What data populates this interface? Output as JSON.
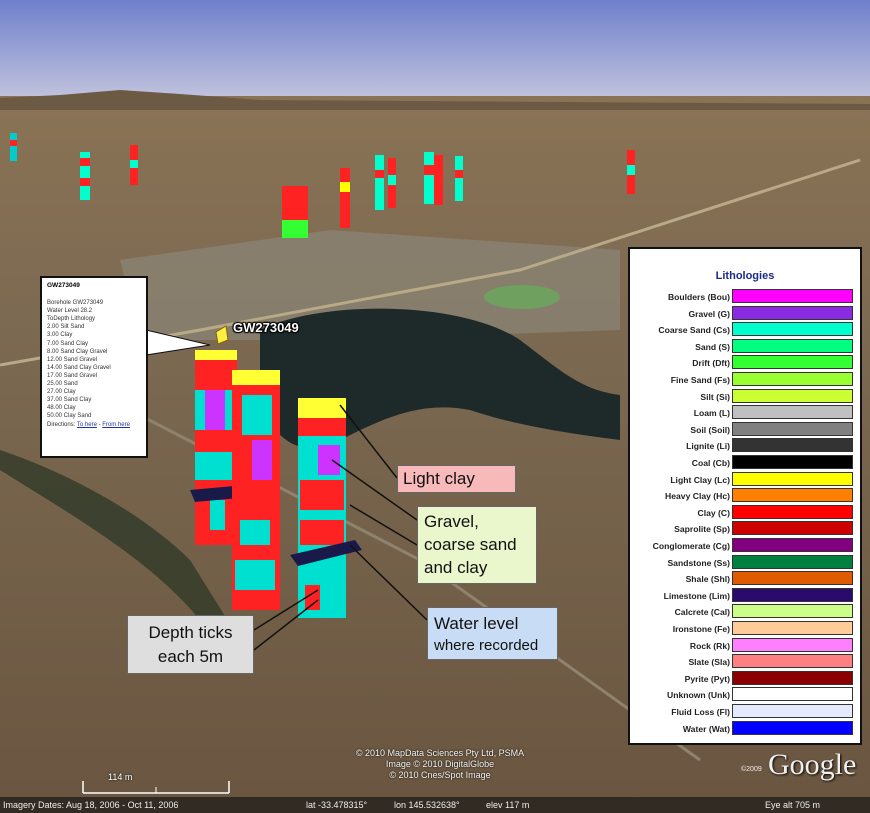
{
  "balloon": {
    "title": "GW273049",
    "lines": [
      "Borehole GW273049",
      "Water Level 28.2",
      "ToDepth Lithology",
      "2.00 Silt Sand",
      "3.00 Clay",
      "7.00 Sand Clay",
      "8.00 Sand Clay Gravel",
      "12.00 Sand Gravel",
      "14.00 Sand Clay Gravel",
      "17.00 Sand Gravel",
      "25.00 Sand",
      "27.00 Clay",
      "37.00 Sand Clay",
      "48.00 Clay",
      "50.00 Clay Sand"
    ],
    "directions_label": "Directions:",
    "to_here": "To here",
    "sep": " - ",
    "from_here": "From here"
  },
  "placemark": {
    "label": "GW273049"
  },
  "callouts": {
    "light_clay": "Light clay",
    "gravel_1": "Gravel,",
    "gravel_2": "coarse sand",
    "gravel_3": "and clay",
    "depth_1": "Depth ticks",
    "depth_2": "each 5m",
    "water_1": "Water level",
    "water_2": "where recorded"
  },
  "legend": {
    "title": "Lithologies",
    "items": [
      {
        "label": "Boulders (Bou)",
        "color": "#ff00ff"
      },
      {
        "label": "Gravel (G)",
        "color": "#8a2be2"
      },
      {
        "label": "Coarse Sand (Cs)",
        "color": "#00ffcc"
      },
      {
        "label": "Sand (S)",
        "color": "#00ff80"
      },
      {
        "label": "Drift (Dft)",
        "color": "#33ff33"
      },
      {
        "label": "Fine Sand (Fs)",
        "color": "#99ff33"
      },
      {
        "label": "Silt (Si)",
        "color": "#ccff33"
      },
      {
        "label": "Loam (L)",
        "color": "#c0c0c0"
      },
      {
        "label": "Soil (Soil)",
        "color": "#808080"
      },
      {
        "label": "Lignite (Li)",
        "color": "#333333"
      },
      {
        "label": "Coal (Cb)",
        "color": "#000000"
      },
      {
        "label": "Light Clay (Lc)",
        "color": "#ffff00"
      },
      {
        "label": "Heavy Clay (Hc)",
        "color": "#ff8000"
      },
      {
        "label": "Clay (C)",
        "color": "#ff0000"
      },
      {
        "label": "Saprolite (Sp)",
        "color": "#cc0000"
      },
      {
        "label": "Conglomerate (Cg)",
        "color": "#800080"
      },
      {
        "label": "Sandstone (Ss)",
        "color": "#008040"
      },
      {
        "label": "Shale (Shl)",
        "color": "#e05a00"
      },
      {
        "label": "Limestone (Lim)",
        "color": "#2a0a6a"
      },
      {
        "label": "Calcrete (Cal)",
        "color": "#ccff88"
      },
      {
        "label": "Ironstone (Fe)",
        "color": "#ffcc99"
      },
      {
        "label": "Rock (Rk)",
        "color": "#ff80ff"
      },
      {
        "label": "Slate (Sla)",
        "color": "#ff8080"
      },
      {
        "label": "Pyrite (Pyt)",
        "color": "#8b0000"
      },
      {
        "label": "Unknown (Unk)",
        "color": "#ffffff"
      },
      {
        "label": "Fluid Loss (Fl)",
        "color": "#e6eaff"
      },
      {
        "label": "Water (Wat)",
        "color": "#0000ff"
      }
    ]
  },
  "map": {
    "copyright_1": "© 2010 MapData Sciences Pty Ltd, PSMA",
    "copyright_2": "Image © 2010 DigitalGlobe",
    "copyright_3": "© 2010 Cnes/Spot Image",
    "logo": "Google",
    "logo_year": "©2009",
    "scale": "114 m"
  },
  "status": {
    "imagery_dates": "Imagery Dates: Aug 18, 2006 - Oct 11, 2006",
    "lat": "lat  -33.478315°",
    "lon": "lon  145.532638°",
    "elev": "elev  117 m",
    "eye_alt": "Eye alt      705 m"
  }
}
